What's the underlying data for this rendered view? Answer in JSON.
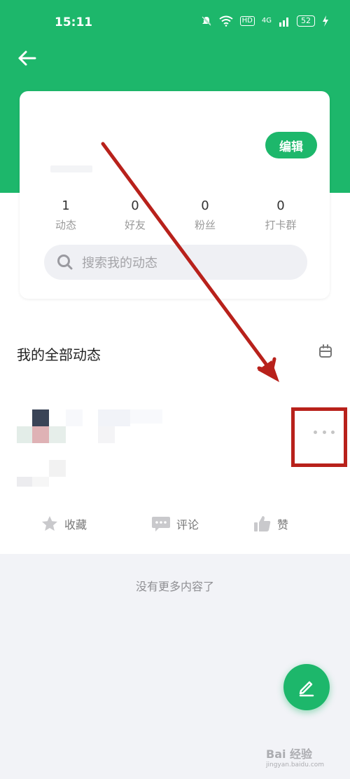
{
  "status_bar": {
    "time": "15:11",
    "hd": "HD",
    "network": "4G",
    "battery": "52"
  },
  "profile": {
    "edit_label": "编辑"
  },
  "stats": [
    {
      "value": "1",
      "label": "动态"
    },
    {
      "value": "0",
      "label": "好友"
    },
    {
      "value": "0",
      "label": "粉丝"
    },
    {
      "value": "0",
      "label": "打卡群"
    }
  ],
  "search": {
    "placeholder": "搜索我的动态"
  },
  "feed": {
    "title": "我的全部动态",
    "actions": {
      "favorite": "收藏",
      "comment": "评论",
      "like": "赞"
    },
    "empty_tip": "没有更多内容了"
  },
  "watermark": {
    "brand": "Bai 经验",
    "url": "jingyan.baidu.com"
  },
  "colors": {
    "accent": "#1db76b",
    "annotation": "#b8211b",
    "background": "#f2f3f7"
  }
}
